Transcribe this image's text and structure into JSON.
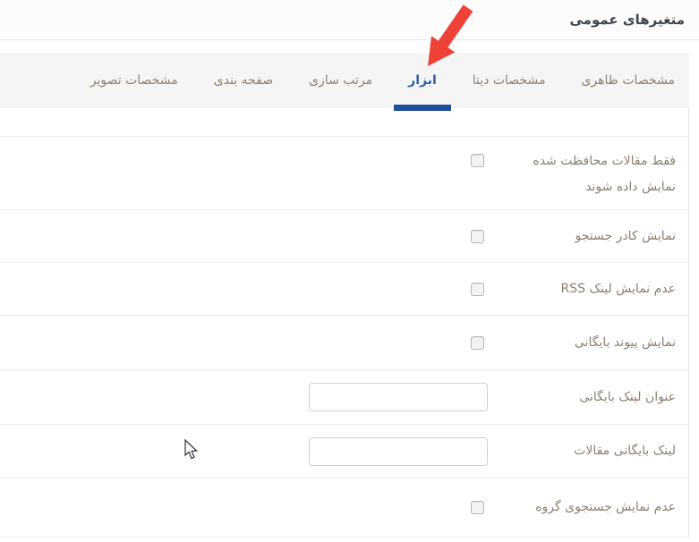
{
  "header": {
    "title": "متغیرهای عمومی"
  },
  "tabs": [
    {
      "key": "appearance",
      "label": "مشخصات ظاهری",
      "active": false
    },
    {
      "key": "data",
      "label": "مشخصات دیتا",
      "active": false
    },
    {
      "key": "tools",
      "label": "ابزار",
      "active": true
    },
    {
      "key": "sorting",
      "label": "مرتب سازی",
      "active": false
    },
    {
      "key": "pagination",
      "label": "صفحه بندی",
      "active": false
    },
    {
      "key": "image",
      "label": "مشخصات تصویر",
      "active": false
    }
  ],
  "rows": [
    {
      "key": "protected-articles",
      "type": "checkbox",
      "label": [
        "فقط مقالات محافظت شده",
        "نمایش داده شوند"
      ],
      "checked": false
    },
    {
      "key": "search-box",
      "type": "checkbox",
      "label": "نمایش کادر جستجو",
      "checked": false
    },
    {
      "key": "rss-link",
      "type": "checkbox",
      "label": "عدم نمایش لینک RSS",
      "checked": false
    },
    {
      "key": "archive-link",
      "type": "checkbox",
      "label": "نمایش پیوند بایگانی",
      "checked": false
    },
    {
      "key": "archive-link-title",
      "type": "text",
      "label": "عنوان لینک بایگانی",
      "value": "",
      "placeholder": ""
    },
    {
      "key": "articles-archive-link",
      "type": "text",
      "label": "لینک بایگانی مقالات",
      "value": "",
      "placeholder": ""
    },
    {
      "key": "group-search",
      "type": "checkbox",
      "label": "عدم نمایش جستجوی گروه",
      "checked": false
    }
  ],
  "colors": {
    "accent_blue": "#1c509c",
    "active_tab_text": "#2d5fa6",
    "arrow_red": "#ee4138",
    "label_brown_gray": "#8e7f71"
  }
}
